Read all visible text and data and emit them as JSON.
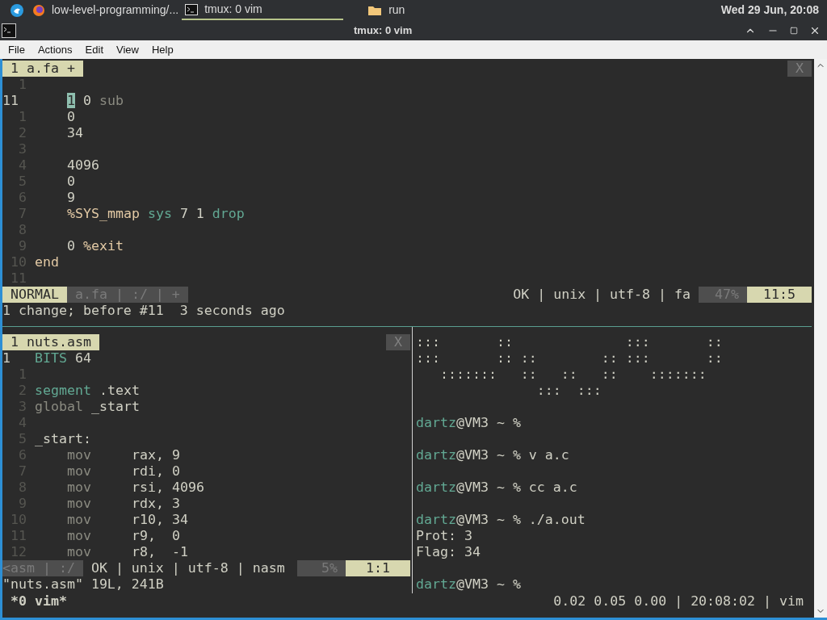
{
  "taskbar": {
    "tasks": [
      {
        "kind": "browser",
        "label": "low-level-programming/...",
        "selected": false
      },
      {
        "kind": "terminal",
        "label": "tmux: 0 vim",
        "selected": true
      },
      {
        "kind": "folder",
        "label": "run",
        "selected": false
      }
    ],
    "clock": "Wed 29 Jun, 20:08"
  },
  "window": {
    "title": "tmux: 0 vim"
  },
  "menu": [
    "File",
    "Actions",
    "Edit",
    "View",
    "Help"
  ],
  "top_pane": {
    "tab": "1 a.fa +",
    "close": "X",
    "lines": [
      {
        "number": "1",
        "current": false
      },
      {
        "number": "11",
        "current": true,
        "kind": "indented",
        "code": [
          {
            "t": "1",
            "kind": "cursor"
          },
          {
            "t": " 0 ",
            "kind": "text"
          },
          {
            "t": "sub",
            "kind": "dim"
          }
        ]
      },
      {
        "number": "1",
        "current": false,
        "kind": "indented",
        "code": [
          {
            "t": "0",
            "kind": "text"
          }
        ]
      },
      {
        "number": "2",
        "current": false,
        "kind": "indented",
        "code": [
          {
            "t": "34",
            "kind": "text"
          }
        ]
      },
      {
        "number": "3",
        "current": false
      },
      {
        "number": "4",
        "current": false,
        "kind": "indented",
        "code": [
          {
            "t": "4096",
            "kind": "text"
          }
        ]
      },
      {
        "number": "5",
        "current": false,
        "kind": "indented",
        "code": [
          {
            "t": "0",
            "kind": "text"
          }
        ]
      },
      {
        "number": "6",
        "current": false,
        "kind": "indented",
        "code": [
          {
            "t": "9",
            "kind": "text"
          }
        ]
      },
      {
        "number": "7",
        "current": false,
        "kind": "indented",
        "code": [
          {
            "t": "%SYS_mmap",
            "kind": "special"
          },
          {
            "t": " sys",
            "kind": "keyword"
          },
          {
            "t": " 7 1 ",
            "kind": "text"
          },
          {
            "t": "drop",
            "kind": "keyword"
          }
        ]
      },
      {
        "number": "8",
        "current": false
      },
      {
        "number": "9",
        "current": false,
        "kind": "indented",
        "code": [
          {
            "t": "0 ",
            "kind": "text"
          },
          {
            "t": "%exit",
            "kind": "special"
          }
        ]
      },
      {
        "number": "10",
        "current": false,
        "kind": "plain",
        "code": [
          {
            "t": "end",
            "kind": "special"
          }
        ]
      },
      {
        "number": "11",
        "current": false
      }
    ],
    "status": {
      "mode": "NORMAL",
      "left": "a.fa | :/ | +",
      "right": "OK | unix | utf-8 | fa",
      "percent": "47%",
      "position": "11:5"
    },
    "message": "1 change; before #11  3 seconds ago"
  },
  "bottom_left_pane": {
    "tab": "1 nuts.asm",
    "close": "X",
    "lines": [
      {
        "number": "1",
        "current": true,
        "kind": "plain",
        "code": [
          {
            "t": "BITS",
            "kind": "keyword"
          },
          {
            "t": " 64",
            "kind": "text"
          }
        ]
      },
      {
        "number": "1",
        "current": false
      },
      {
        "number": "2",
        "current": false,
        "kind": "plain",
        "code": [
          {
            "t": "segment",
            "kind": "keyword"
          },
          {
            "t": " .text",
            "kind": "text"
          }
        ]
      },
      {
        "number": "3",
        "current": false,
        "kind": "plain",
        "code": [
          {
            "t": "global",
            "kind": "dim"
          },
          {
            "t": " _start",
            "kind": "text"
          }
        ]
      },
      {
        "number": "4",
        "current": false
      },
      {
        "number": "5",
        "current": false,
        "kind": "plain",
        "code": [
          {
            "t": "_start:",
            "kind": "text"
          }
        ]
      },
      {
        "number": "6",
        "current": false,
        "kind": "indented",
        "code": [
          {
            "t": "mov",
            "kind": "instruction"
          },
          {
            "t": "rax, 9",
            "kind": "text"
          }
        ]
      },
      {
        "number": "7",
        "current": false,
        "kind": "indented",
        "code": [
          {
            "t": "mov",
            "kind": "instruction"
          },
          {
            "t": "rdi, 0",
            "kind": "text"
          }
        ]
      },
      {
        "number": "8",
        "current": false,
        "kind": "indented",
        "code": [
          {
            "t": "mov",
            "kind": "instruction"
          },
          {
            "t": "rsi, 4096",
            "kind": "text"
          }
        ]
      },
      {
        "number": "9",
        "current": false,
        "kind": "indented",
        "code": [
          {
            "t": "mov",
            "kind": "instruction"
          },
          {
            "t": "rdx, 3",
            "kind": "text"
          }
        ]
      },
      {
        "number": "10",
        "current": false,
        "kind": "indented",
        "code": [
          {
            "t": "mov",
            "kind": "instruction"
          },
          {
            "t": "r10, 34",
            "kind": "text"
          }
        ]
      },
      {
        "number": "11",
        "current": false,
        "kind": "indented",
        "code": [
          {
            "t": "mov",
            "kind": "instruction"
          },
          {
            "t": "r9,  0",
            "kind": "text"
          }
        ]
      },
      {
        "number": "12",
        "current": false,
        "kind": "indented",
        "code": [
          {
            "t": "mov",
            "kind": "instruction"
          },
          {
            "t": "r8,  -1",
            "kind": "text"
          }
        ]
      }
    ],
    "status": {
      "left": "<asm | :/",
      "right": "OK | unix | utf-8 | nasm",
      "percent": "5%",
      "position": "1:1"
    },
    "message": "\"nuts.asm\" 19L, 241B"
  },
  "shell_pane": {
    "blocks": [
      [
        [
          {
            "t": ":::       ::              :::       ::",
            "kind": "text"
          }
        ],
        [
          {
            "t": ":::       :: ::        :: :::       ::",
            "kind": "text"
          }
        ],
        [
          {
            "t": "   :::::::   ::   ::   ::    :::::::",
            "kind": "text"
          }
        ],
        [
          {
            "t": "               :::  :::",
            "kind": "text"
          }
        ]
      ],
      [
        [
          {
            "t": "dartz",
            "kind": "keyword"
          },
          {
            "t": "@VM3 ~ %",
            "kind": "text"
          }
        ]
      ],
      [
        [
          {
            "t": "dartz",
            "kind": "keyword"
          },
          {
            "t": "@VM3 ~ % v a.c",
            "kind": "text"
          }
        ]
      ],
      [
        [
          {
            "t": "dartz",
            "kind": "keyword"
          },
          {
            "t": "@VM3 ~ % cc a.c",
            "kind": "text"
          }
        ]
      ],
      [
        [
          {
            "t": "dartz",
            "kind": "keyword"
          },
          {
            "t": "@VM3 ~ % ./a.out",
            "kind": "text"
          }
        ],
        [
          {
            "t": "Prot: 3",
            "kind": "text"
          }
        ],
        [
          {
            "t": "Flag: 34",
            "kind": "text"
          }
        ]
      ],
      [
        [
          {
            "t": "dartz",
            "kind": "keyword"
          },
          {
            "t": "@VM3 ~ %",
            "kind": "text"
          }
        ]
      ]
    ]
  },
  "tmux_status": {
    "left": "*0 vim*",
    "right": "0.02 0.05 0.00 | 20:08:02 | vim"
  }
}
